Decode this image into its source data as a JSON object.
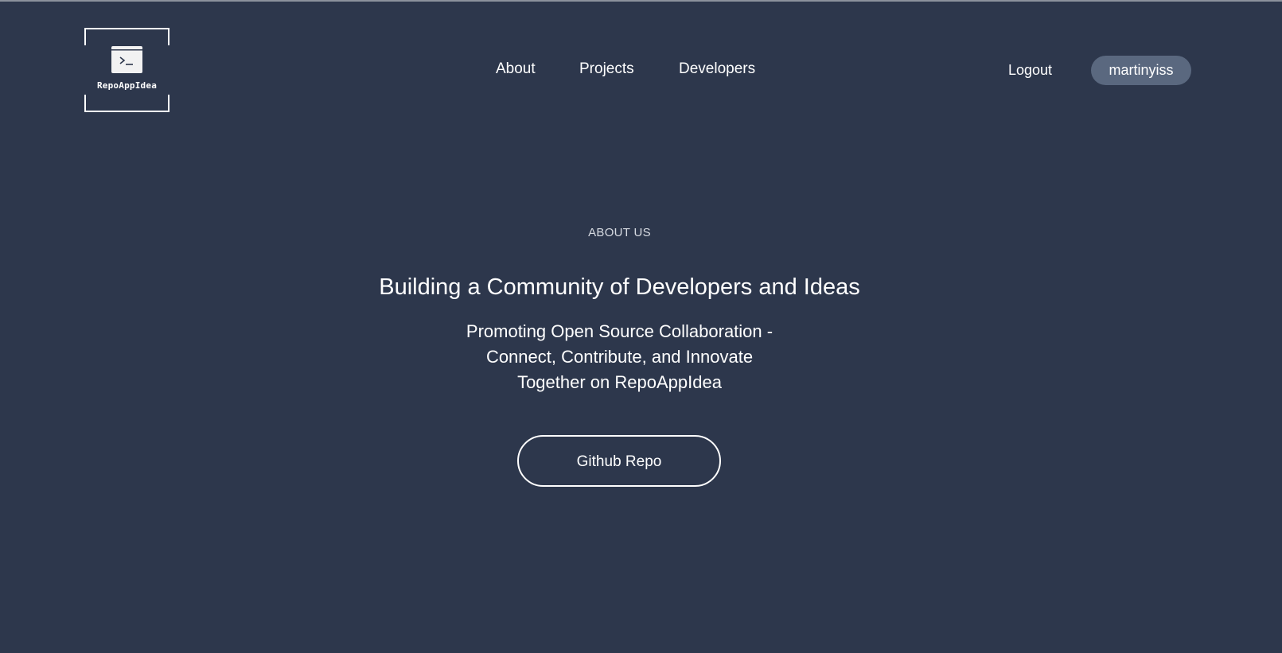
{
  "logo": {
    "text": "RepoAppIdea",
    "icon": "terminal-icon"
  },
  "nav": {
    "items": [
      {
        "label": "About"
      },
      {
        "label": "Projects"
      },
      {
        "label": "Developers"
      }
    ]
  },
  "account": {
    "logout_label": "Logout",
    "username": "martinyiss"
  },
  "hero": {
    "eyebrow": "ABOUT US",
    "headline": "Building a Community of Developers and Ideas",
    "subline": [
      "Promoting Open Source Collaboration -",
      "Connect, Contribute, and Innovate",
      "Together on RepoAppIdea"
    ],
    "cta_label": "Github Repo"
  },
  "colors": {
    "background": "#2d374c",
    "pill": "#5a687f",
    "text": "#ffffff"
  }
}
